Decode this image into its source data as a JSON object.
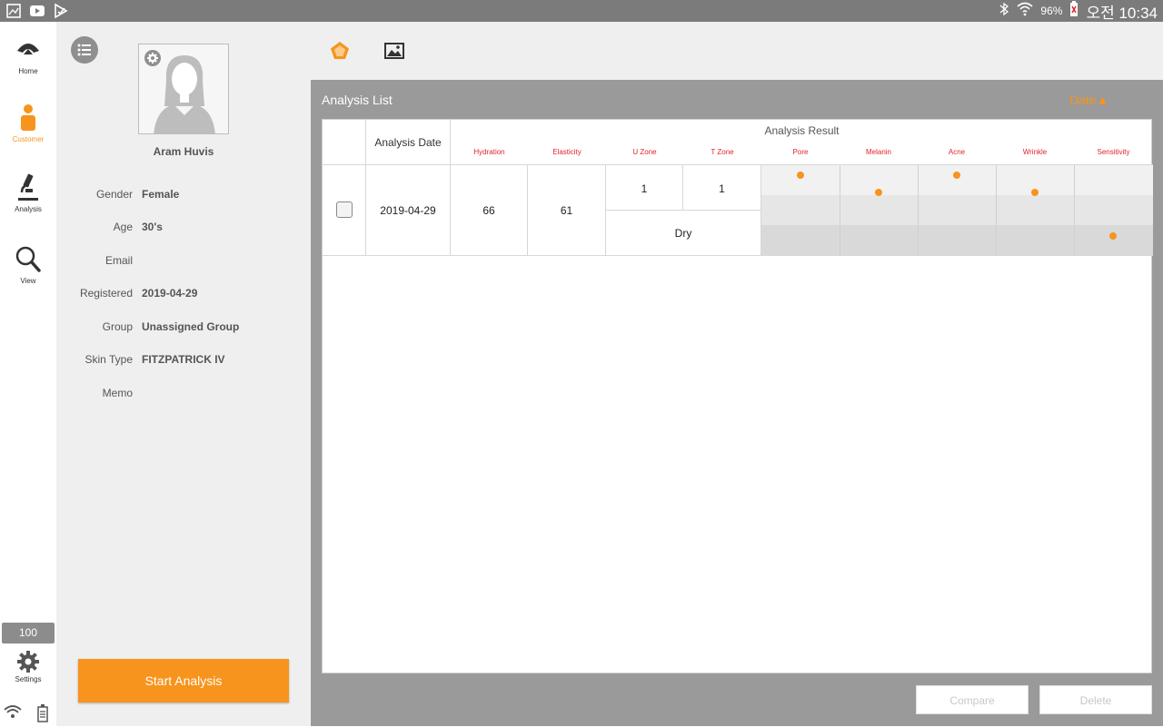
{
  "status_bar": {
    "battery_pct": "96%",
    "time": "오전 10:34"
  },
  "rail": {
    "items": [
      {
        "label": "Home"
      },
      {
        "label": "Customer"
      },
      {
        "label": "Analysis"
      },
      {
        "label": "View"
      }
    ],
    "badge": "100",
    "settings_label": "Settings"
  },
  "customer": {
    "name": "Aram Huvis",
    "fields": [
      {
        "key": "Gender",
        "value": "Female"
      },
      {
        "key": "Age",
        "value": "30's"
      },
      {
        "key": "Email",
        "value": ""
      },
      {
        "key": "Registered",
        "value": "2019-04-29"
      },
      {
        "key": "Group",
        "value": "Unassigned Group"
      },
      {
        "key": "Skin Type",
        "value": "FITZPATRICK IV"
      },
      {
        "key": "Memo",
        "value": ""
      }
    ],
    "start_button": "Start Analysis"
  },
  "analysis": {
    "title": "Analysis List",
    "sort_label": "Date▲",
    "header": {
      "date": "Analysis Date",
      "result": "Analysis Result",
      "columns": [
        "Hydration",
        "Elasticity",
        "U Zone",
        "T Zone",
        "Pore",
        "Melanin",
        "Acne",
        "Wrinkle",
        "Sensitivity"
      ]
    },
    "rows": [
      {
        "date": "2019-04-29",
        "hydration": "66",
        "elasticity": "61",
        "u_zone": "1",
        "t_zone": "1",
        "oil_type": "Dry",
        "levels": {
          "Pore": 1,
          "Melanin": 2,
          "Acne": 1,
          "Wrinkle": 2,
          "Sensitivity": 3
        }
      }
    ],
    "buttons": {
      "compare": "Compare",
      "delete": "Delete"
    }
  },
  "colors": {
    "accent": "#f7941d",
    "label_red": "#e0232d"
  }
}
